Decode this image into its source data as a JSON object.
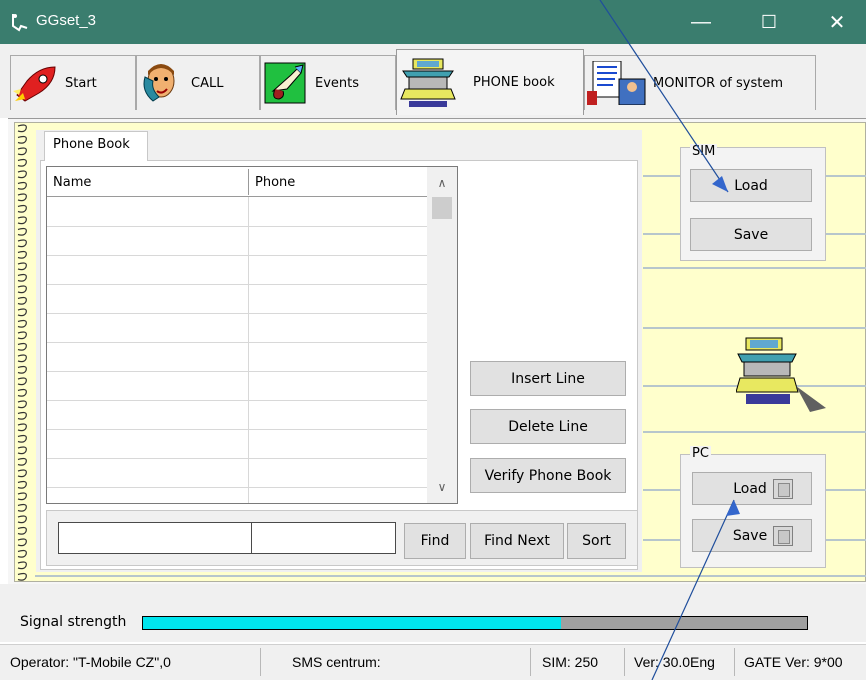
{
  "window": {
    "title": "GGset_3",
    "minimize": "—",
    "maximize": "☐",
    "close": "✕"
  },
  "tabs": [
    {
      "label": "Start",
      "icon": "rocket-icon"
    },
    {
      "label": "CALL",
      "icon": "phone-caller-icon"
    },
    {
      "label": "Events",
      "icon": "hand-events-icon"
    },
    {
      "label": "PHONE book",
      "icon": "phonebook-icon"
    },
    {
      "label": "MONITOR of system",
      "icon": "monitor-icon"
    }
  ],
  "phonebook": {
    "tab_label": "Phone Book",
    "columns": [
      "Name",
      "Phone"
    ],
    "rows": 11,
    "buttons": {
      "insert": "Insert Line",
      "delete": "Delete Line",
      "verify": "Verify Phone Book"
    },
    "search": {
      "field1": "",
      "field2": "",
      "find": "Find",
      "find_next": "Find Next",
      "sort": "Sort"
    }
  },
  "sim": {
    "label": "SIM",
    "load": "Load",
    "save": "Save"
  },
  "pc": {
    "label": "PC",
    "load": "Load",
    "save": "Save"
  },
  "signal": {
    "label": "Signal strength",
    "level": 0.63,
    "fill_color": "#00e5ee",
    "empty_color": "#a0a0a0"
  },
  "status": {
    "operator": "Operator: \"T-Mobile CZ\",0",
    "sms": "SMS centrum:",
    "sim": "SIM: 250",
    "ver": "Ver: 30.0Eng",
    "gate": "GATE Ver: 9*00"
  },
  "colors": {
    "titlebar": "#3a7d6e",
    "notebook": "#ffffcc",
    "annotation_arrow": "#1f4e9c"
  }
}
